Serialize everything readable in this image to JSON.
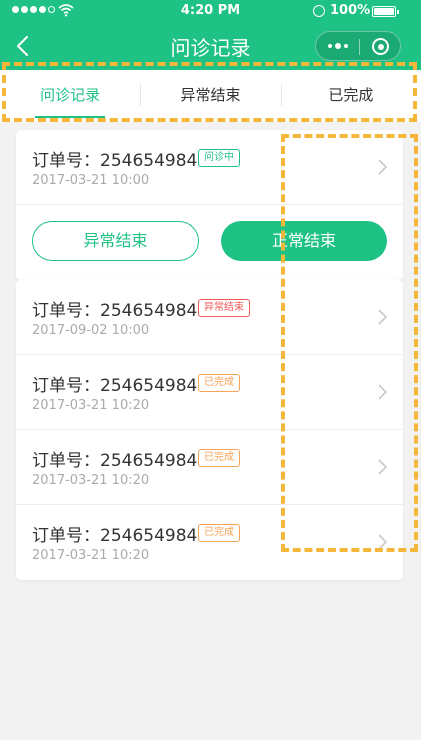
{
  "status_bar": {
    "time": "4:20 PM",
    "battery": "100%"
  },
  "nav": {
    "title": "问诊记录"
  },
  "tabs": [
    {
      "label": "问诊记录"
    },
    {
      "label": "异常结束"
    },
    {
      "label": "已完成"
    }
  ],
  "card1": {
    "order": {
      "label": "订单号：254654984",
      "date": "2017-03-21  10:00",
      "status": "问诊中"
    },
    "buttons": {
      "abnormal": "异常结束",
      "normal": "正常结束"
    }
  },
  "card2": {
    "orders": [
      {
        "label": "订单号：254654984",
        "date": "2017-09-02  10:00",
        "status": "异常结束"
      },
      {
        "label": "订单号：254654984",
        "date": "2017-03-21  10:20",
        "status": "已完成"
      },
      {
        "label": "订单号：254654984",
        "date": "2017-03-21  10:20",
        "status": "已完成"
      },
      {
        "label": "订单号：254654984",
        "date": "2017-03-21  10:20",
        "status": "已完成"
      }
    ]
  },
  "colors": {
    "accent": "#1fc285",
    "abnormal": "#f25555",
    "completed": "#f5a356",
    "highlight": "#f4b73a"
  }
}
